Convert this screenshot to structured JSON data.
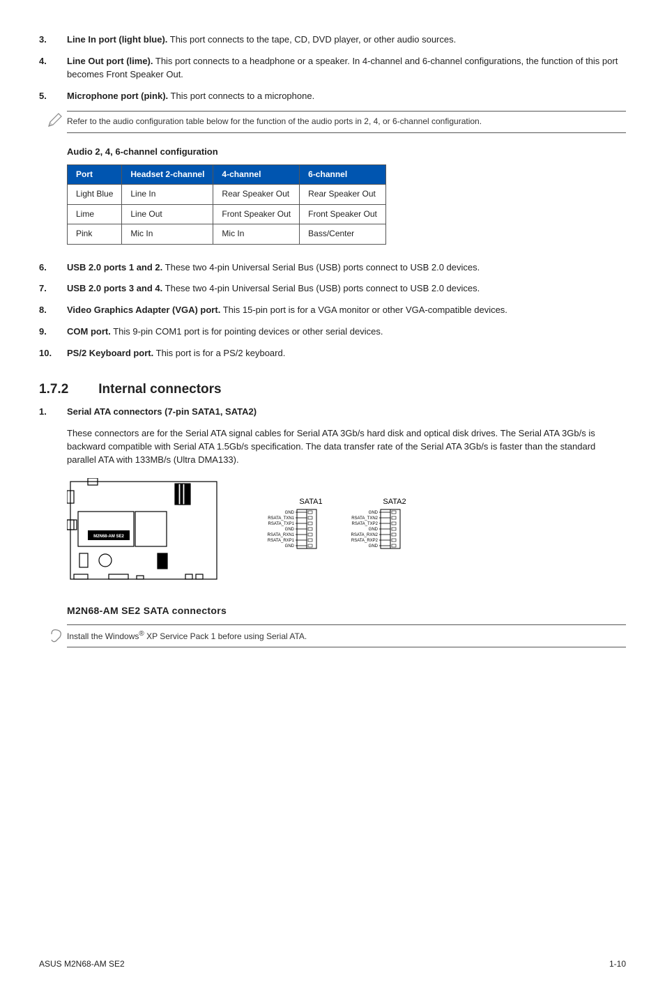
{
  "items_top": [
    {
      "num": "3.",
      "title": "Line In port (light blue).",
      "text": " This port connects to the tape, CD, DVD player, or other audio sources."
    },
    {
      "num": "4.",
      "title": "Line Out port (lime).",
      "text": " This port connects to a headphone or a speaker. In 4-channel and 6-channel configurations, the function of this port becomes Front Speaker Out."
    },
    {
      "num": "5.",
      "title": "Microphone port (pink).",
      "text": " This port connects to a microphone."
    }
  ],
  "note1": "Refer to the audio configuration table below for the function of the audio ports in 2, 4, or 6-channel configuration.",
  "audio_heading": "Audio 2, 4, 6-channel configuration",
  "audio_table": {
    "headers": [
      "Port",
      "Headset 2-channel",
      "4-channel",
      "6-channel"
    ],
    "rows": [
      [
        "Light Blue",
        "Line In",
        "Rear Speaker Out",
        "Rear Speaker Out"
      ],
      [
        "Lime",
        "Line Out",
        "Front Speaker Out",
        "Front Speaker Out"
      ],
      [
        "Pink",
        "Mic In",
        "Mic In",
        "Bass/Center"
      ]
    ]
  },
  "items_mid": [
    {
      "num": "6.",
      "title": "USB 2.0 ports 1 and 2.",
      "text": " These two 4-pin Universal Serial Bus (USB) ports connect to USB 2.0 devices."
    },
    {
      "num": "7.",
      "title": "USB 2.0 ports 3 and 4.",
      "text": " These two 4-pin Universal Serial Bus (USB) ports connect to USB 2.0 devices."
    },
    {
      "num": "8.",
      "title": "Video Graphics Adapter (VGA) port.",
      "text": " This 15-pin port is for a VGA monitor or other VGA-compatible devices."
    },
    {
      "num": "9.",
      "title": "COM port.",
      "text": " This 9-pin COM1 port is for pointing devices or other serial devices."
    },
    {
      "num": "10.",
      "title": "PS/2 Keyboard port.",
      "text": " This port is for a PS/2 keyboard."
    }
  ],
  "section": {
    "num": "1.7.2",
    "title": "Internal connectors"
  },
  "items_bottom": [
    {
      "num": "1.",
      "title": "Serial ATA connectors (7-pin SATA1, SATA2)",
      "text": ""
    }
  ],
  "sata_para": "These connectors are for the Serial ATA signal cables for Serial ATA 3Gb/s hard disk and optical disk drives. The Serial ATA 3Gb/s is backward compatible with Serial ATA 1.5Gb/s specification. The data transfer rate of the Serial ATA 3Gb/s is faster than the standard parallel ATA with 133MB/s (Ultra DMA133).",
  "fig_caption": "M2N68-AM SE2 SATA connectors",
  "fig_labels": {
    "board": "M2N68-AM SE2",
    "sata1": "SATA1",
    "sata2": "SATA2",
    "pins1": [
      "GND",
      "RSATA_TXN1",
      "RSATA_TXP1",
      "GND",
      "RSATA_RXN1",
      "RSATA_RXP1",
      "GND"
    ],
    "pins2": [
      "GND",
      "RSATA_TXN2",
      "RSATA_TXP2",
      "GND",
      "RSATA_RXN2",
      "RSATA_RXP2",
      "GND"
    ]
  },
  "note2_pre": "Install the Windows",
  "note2_sup": "®",
  "note2_post": " XP Service Pack 1 before using Serial ATA.",
  "footer": {
    "left": "ASUS M2N68-AM SE2",
    "right": "1-10"
  }
}
